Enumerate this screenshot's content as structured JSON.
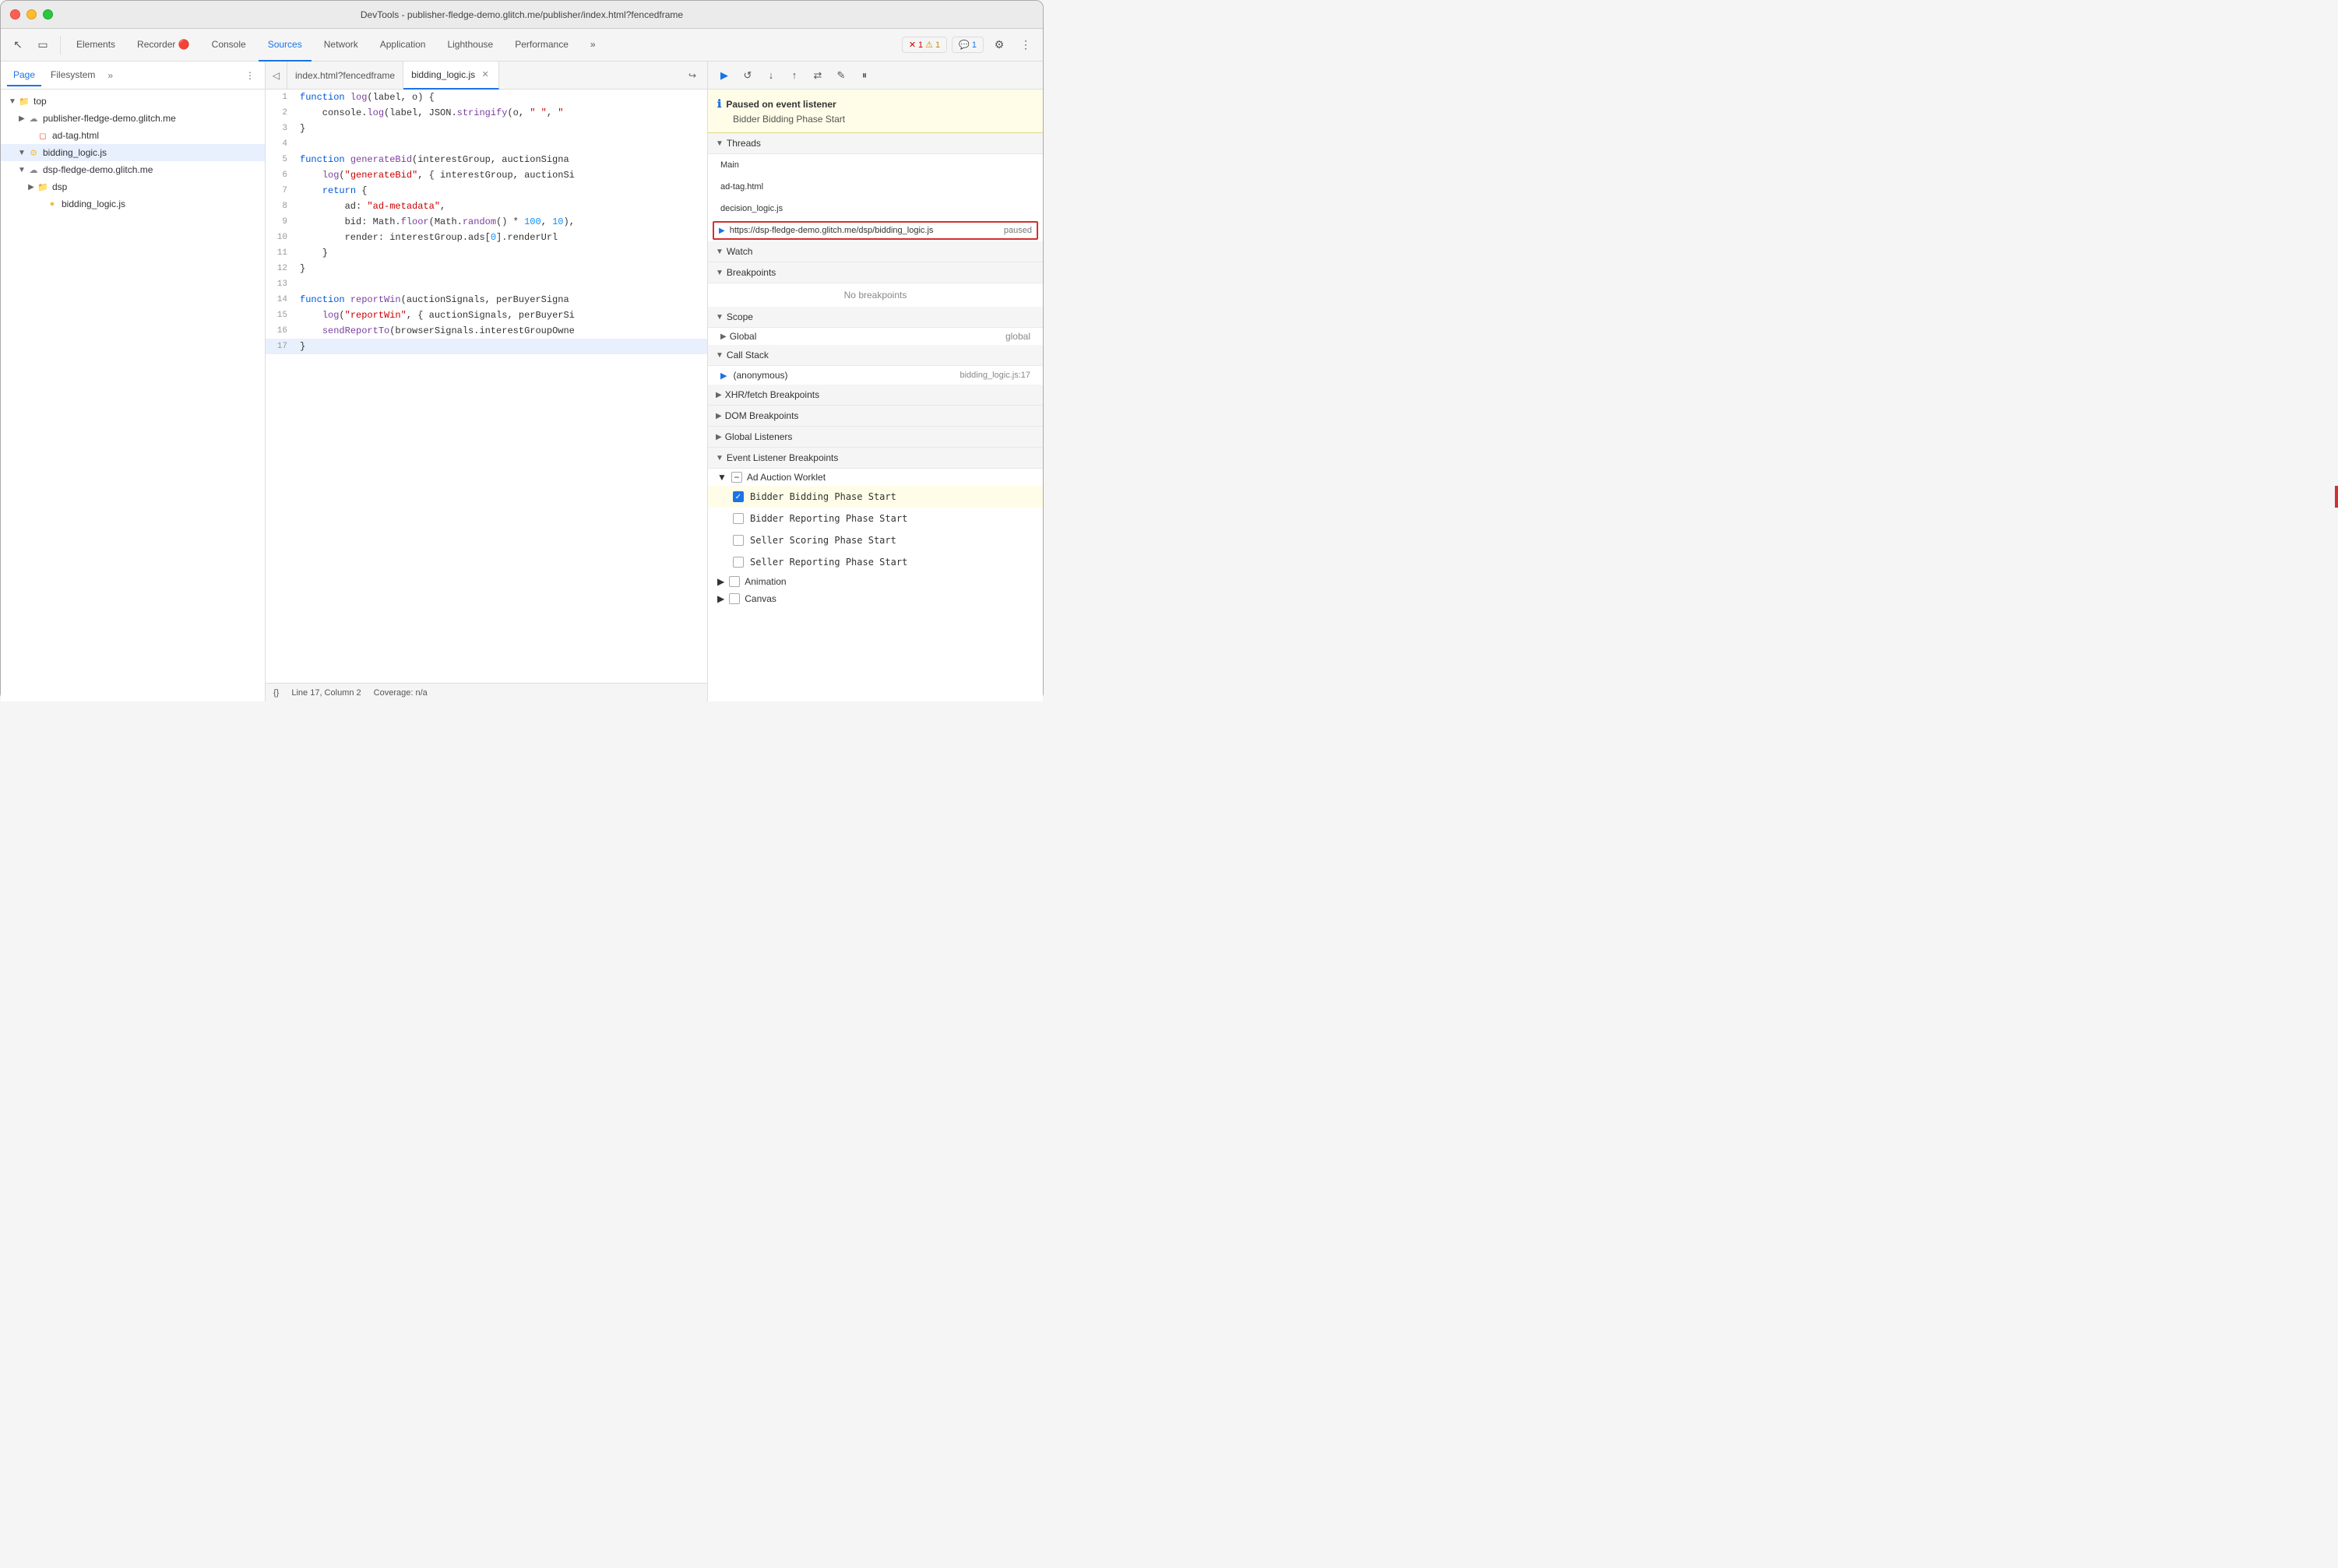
{
  "window": {
    "title": "DevTools - publisher-fledge-demo.glitch.me/publisher/index.html?fencedframe"
  },
  "toolbar": {
    "tabs": [
      "Elements",
      "Recorder",
      "Console",
      "Sources",
      "Network",
      "Application",
      "Lighthouse",
      "Performance"
    ],
    "active_tab": "Sources",
    "more_label": "»",
    "error_count": "1",
    "warning_count": "1",
    "message_count": "1",
    "settings_icon": "⚙",
    "more_icon": "⋮"
  },
  "file_panel": {
    "tabs": [
      "Page",
      "Filesystem",
      "»"
    ],
    "active_tab": "Page",
    "more_icon": "⋮",
    "tree": [
      {
        "level": 0,
        "arrow": "▼",
        "icon": "folder",
        "label": "top"
      },
      {
        "level": 1,
        "arrow": "▶",
        "icon": "cloud",
        "label": "publisher-fledge-demo.glitch.me"
      },
      {
        "level": 2,
        "arrow": "",
        "icon": "html",
        "label": "ad-tag.html"
      },
      {
        "level": 1,
        "arrow": "▼",
        "icon": "js",
        "label": "bidding_logic.js",
        "selected": true
      },
      {
        "level": 1,
        "arrow": "▼",
        "icon": "cloud",
        "label": "dsp-fledge-demo.glitch.me"
      },
      {
        "level": 2,
        "arrow": "▶",
        "icon": "folder",
        "label": "dsp"
      },
      {
        "level": 3,
        "arrow": "",
        "icon": "js",
        "label": "bidding_logic.js"
      }
    ]
  },
  "code_panel": {
    "tabs": [
      {
        "label": "index.html?fencedframe",
        "active": false,
        "closable": false
      },
      {
        "label": "bidding_logic.js",
        "active": true,
        "closable": true
      }
    ],
    "lines": [
      {
        "num": 1,
        "code": "function log(label, o) {"
      },
      {
        "num": 2,
        "code": "    console.log(label, JSON.stringify(o, \" \", \""
      },
      {
        "num": 3,
        "code": "}"
      },
      {
        "num": 4,
        "code": ""
      },
      {
        "num": 5,
        "code": "function generateBid(interestGroup, auctionSigna"
      },
      {
        "num": 6,
        "code": "    log(\"generateBid\", { interestGroup, auctionSi"
      },
      {
        "num": 7,
        "code": "    return {"
      },
      {
        "num": 8,
        "code": "        ad: \"ad-metadata\","
      },
      {
        "num": 9,
        "code": "        bid: Math.floor(Math.random() * 100, 10),"
      },
      {
        "num": 10,
        "code": "        render: interestGroup.ads[0].renderUrl"
      },
      {
        "num": 11,
        "code": "    }"
      },
      {
        "num": 12,
        "code": "}"
      },
      {
        "num": 13,
        "code": ""
      },
      {
        "num": 14,
        "code": "function reportWin(auctionSignals, perBuyerSigna"
      },
      {
        "num": 15,
        "code": "    log(\"reportWin\", { auctionSignals, perBuyerSi"
      },
      {
        "num": 16,
        "code": "    sendReportTo(browserSignals.interestGroupOwne"
      },
      {
        "num": 17,
        "code": "}",
        "highlighted": true
      }
    ],
    "statusbar": {
      "formatter": "{}",
      "line_col": "Line 17, Column 2",
      "coverage": "Coverage: n/a"
    }
  },
  "debug_panel": {
    "toolbar_buttons": [
      "▶",
      "↺",
      "↓",
      "↑",
      "⇄",
      "✎",
      "⏸"
    ],
    "pause_notice": {
      "title": "Paused on event listener",
      "subtitle": "Bidder Bidding Phase Start"
    },
    "threads_section": "Threads",
    "threads": [
      {
        "label": "Main"
      },
      {
        "label": "ad-tag.html"
      },
      {
        "label": "decision_logic.js"
      },
      {
        "label": "https://dsp-fledge-demo.glitch.me/dsp/bidding_logic.js",
        "status": "paused",
        "active": true
      }
    ],
    "watch_section": "Watch",
    "breakpoints_section": "Breakpoints",
    "breakpoints_empty": "No breakpoints",
    "scope_section": "Scope",
    "scope_items": [
      {
        "label": "▶ Global",
        "value": "global"
      }
    ],
    "callstack_section": "Call Stack",
    "callstack_items": [
      {
        "label": "(anonymous)",
        "location": "bidding_logic.js:17"
      }
    ],
    "xhr_section": "XHR/fetch Breakpoints",
    "dom_section": "DOM Breakpoints",
    "global_listeners_section": "Global Listeners",
    "event_listener_section": "Event Listener Breakpoints",
    "ad_auction_section": "Ad Auction Worklet",
    "bp_items": [
      {
        "label": "Bidder Bidding Phase Start",
        "checked": true,
        "highlighted": true
      },
      {
        "label": "Bidder Reporting Phase Start",
        "checked": false
      },
      {
        "label": "Seller Scoring Phase Start",
        "checked": false
      },
      {
        "label": "Seller Reporting Phase Start",
        "checked": false
      }
    ],
    "animation_section": "Animation",
    "canvas_section": "Canvas"
  }
}
